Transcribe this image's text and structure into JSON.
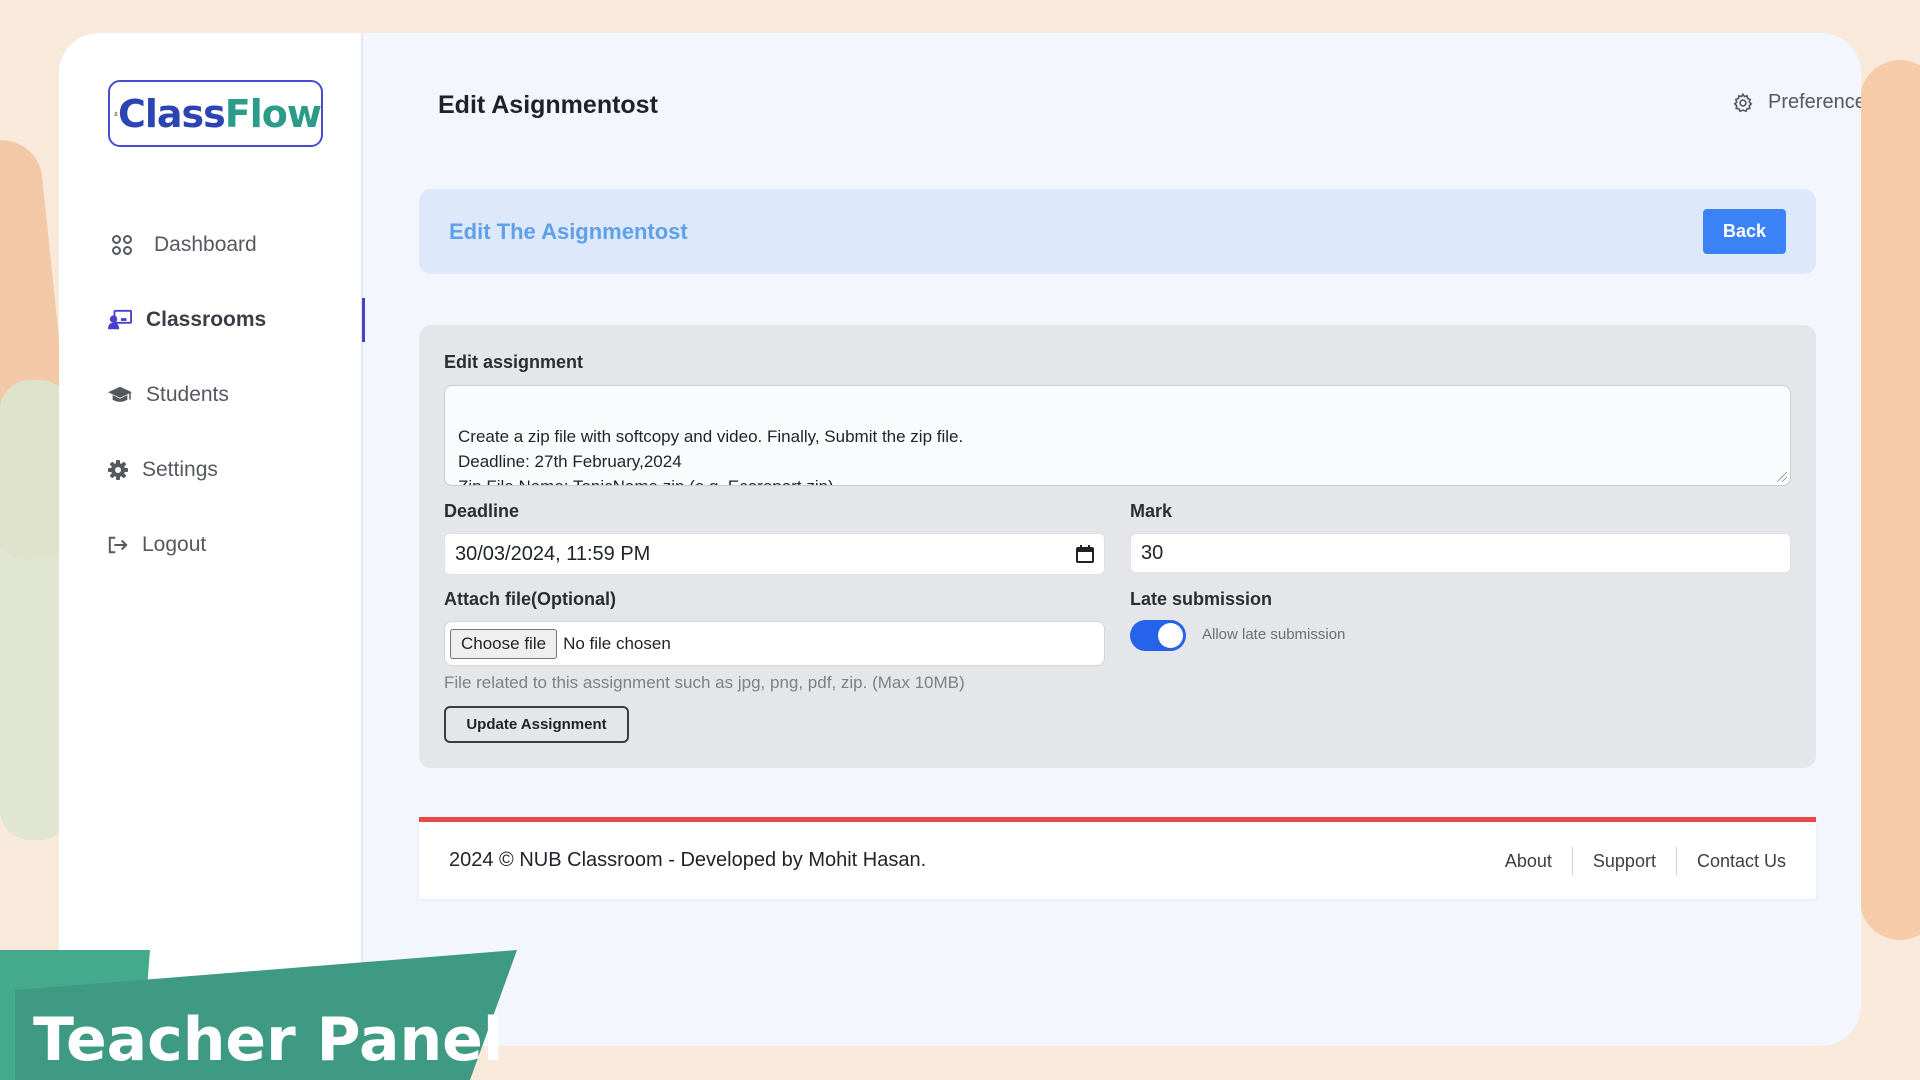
{
  "brand": {
    "part1": "Class",
    "part2": "Flow"
  },
  "sidebar": {
    "items": [
      {
        "label": "Dashboard",
        "icon": "grid-icon"
      },
      {
        "label": "Classrooms",
        "icon": "classroom-icon",
        "active": true
      },
      {
        "label": "Students",
        "icon": "graduation-cap-icon"
      },
      {
        "label": "Settings",
        "icon": "gear-icon"
      },
      {
        "label": "Logout",
        "icon": "logout-icon"
      }
    ]
  },
  "header": {
    "title": "Edit Asignmentost",
    "preferences_label": "Preferences"
  },
  "banner": {
    "title": "Edit The Asignmentost",
    "back_label": "Back"
  },
  "form": {
    "assignment_label": "Edit assignment",
    "assignment_text": "Create a zip file with softcopy and video. Finally, Submit the zip file.\nDeadline: 27th February,2024\nZip File Name: TopicName.zip (e.g. Ecoreport.zip)\nGood Luck",
    "deadline_label": "Deadline",
    "deadline_value": "30/03/2024, 11:59 PM",
    "mark_label": "Mark",
    "mark_value": "30",
    "attach_label": "Attach file(Optional)",
    "choose_file_label": "Choose file",
    "no_file_text": "No file chosen",
    "file_hint": "File related to this assignment such as jpg, png, pdf, zip. (Max 10MB)",
    "late_label": "Late submission",
    "late_toggle_label": "Allow late submission",
    "late_enabled": true,
    "update_label": "Update Assignment"
  },
  "footer": {
    "copyright": "2024 © NUB Classroom - Developed by Mohit Hasan.",
    "links": [
      "About",
      "Support",
      "Contact Us"
    ]
  },
  "ribbon": {
    "text": "Teacher Panel"
  },
  "colors": {
    "accent": "#3b82f6",
    "toggle": "#2563eb",
    "footer_border": "#e94848",
    "ribbon": "#3e9a82"
  }
}
